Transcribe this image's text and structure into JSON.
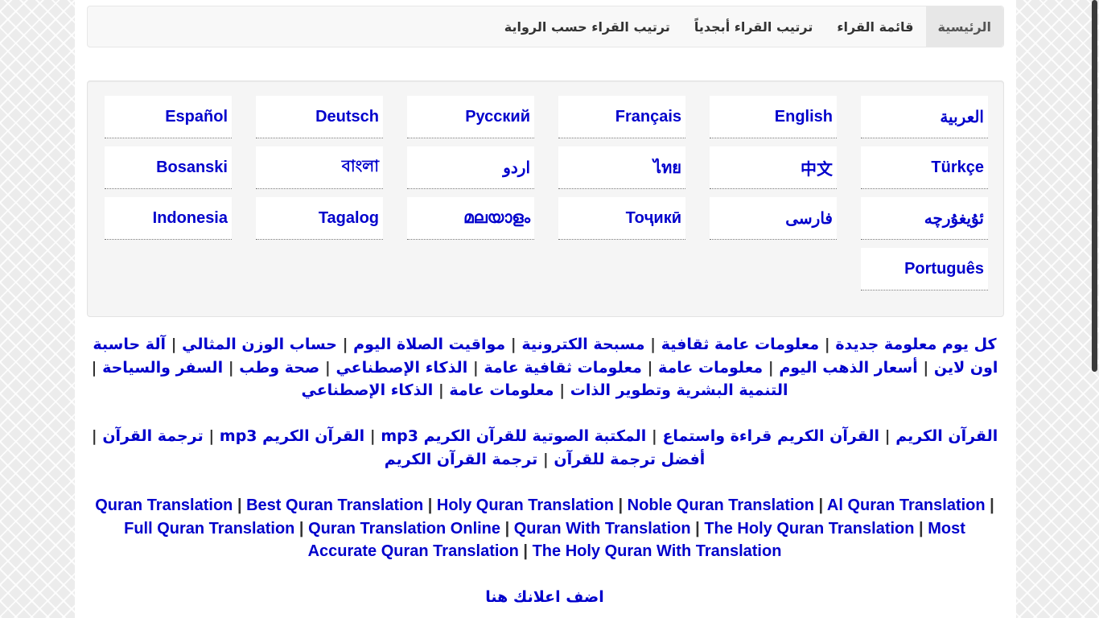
{
  "nav": {
    "items": [
      {
        "label": "الرئيسية",
        "active": true
      },
      {
        "label": "قائمة القراء",
        "active": false
      },
      {
        "label": "ترتيب القراء أبجدياً",
        "active": false
      },
      {
        "label": "ترتيب القراء حسب الرواية",
        "active": false
      }
    ]
  },
  "languages": [
    "العربية",
    "English",
    "Français",
    "Русский",
    "Deutsch",
    "Español",
    "Türkçe",
    "中文",
    "ไทย",
    "اردو",
    "বাংলা",
    "Bosanski",
    "ئۇيغۇرچە",
    "فارسی",
    "Тоҷикӣ",
    "മലയാളം",
    "Tagalog",
    "Indonesia",
    "Português"
  ],
  "link_groups": [
    {
      "dir": "rtl",
      "links": [
        "كل يوم معلومة جديدة",
        "معلومات عامة ثقافية",
        "مسبحة الكترونية",
        "مواقيت الصلاة اليوم",
        "حساب الوزن المثالي",
        "آلة حاسبة اون لاين",
        "أسعار الذهب اليوم",
        "معلومات عامة",
        "معلومات ثقافية عامة",
        "الذكاء الإصطناعي",
        "صحة وطب",
        "السفر والسياحة",
        "التنمية البشرية وتطوير الذات",
        "معلومات عامة",
        "الذكاء الإصطناعي"
      ],
      "trailing_sep_after": [
        5
      ]
    },
    {
      "dir": "rtl",
      "links": [
        "القرآن الكريم",
        "القرآن الكريم قراءة واستماع",
        "المكتبة الصوتية للقرآن الكريم mp3",
        "القرآن الكريم mp3",
        "ترجمة القرآن",
        "أفضل ترجمة للقرآن",
        "ترجمة القرآن الكريم"
      ]
    },
    {
      "dir": "ltr",
      "links": [
        "Quran Translation",
        "Best Quran Translation",
        "Holy Quran Translation",
        "Noble Quran Translation",
        "Al Quran Translation",
        "Full Quran Translation",
        "Quran Translation Online",
        "Quran With Translation",
        "The Holy Quran Translation",
        "Most Accurate Quran Translation",
        "The Holy Quran With Translation"
      ],
      "trailing_sep_after": [
        4
      ]
    },
    {
      "dir": "rtl",
      "links": [
        "اضف اعلانك هنا"
      ]
    }
  ],
  "colors": {
    "link": "#0000cc",
    "nav_bg": "#f8f8f8",
    "panel_bg": "#f5f5f5"
  }
}
